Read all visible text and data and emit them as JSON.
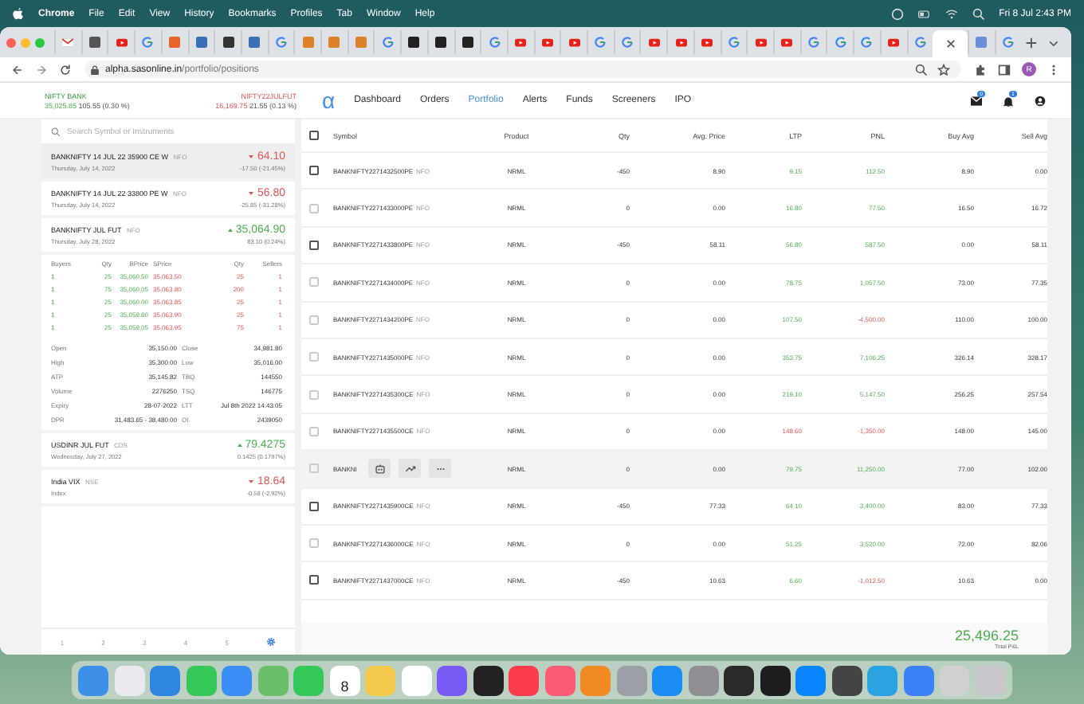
{
  "menu_bar": {
    "app": "Chrome",
    "items": [
      "File",
      "Edit",
      "View",
      "History",
      "Bookmarks",
      "Profiles",
      "Tab",
      "Window",
      "Help"
    ],
    "clock": "Fri 8 Jul  2:43 PM"
  },
  "browser_tabs": [
    {
      "kind": "mail",
      "selected": false
    },
    {
      "kind": "app",
      "color": "#555555",
      "selected": false
    },
    {
      "kind": "youtube",
      "selected": false
    },
    {
      "kind": "google",
      "selected": false
    },
    {
      "kind": "app",
      "color": "#e8632b",
      "selected": false
    },
    {
      "kind": "app",
      "color": "#3b6fb6",
      "selected": false
    },
    {
      "kind": "app",
      "color": "#333333",
      "selected": false
    },
    {
      "kind": "app",
      "color": "#3b6fb6",
      "selected": false
    },
    {
      "kind": "google",
      "selected": false
    },
    {
      "kind": "app",
      "color": "#d9822b",
      "selected": false
    },
    {
      "kind": "app",
      "color": "#d9822b",
      "selected": false
    },
    {
      "kind": "app",
      "color": "#d9822b",
      "selected": false
    },
    {
      "kind": "google",
      "selected": false
    },
    {
      "kind": "app",
      "color": "#222222",
      "selected": false
    },
    {
      "kind": "app",
      "color": "#222222",
      "selected": false
    },
    {
      "kind": "app",
      "color": "#222222",
      "selected": false
    },
    {
      "kind": "google",
      "selected": false
    },
    {
      "kind": "youtube",
      "selected": false
    },
    {
      "kind": "youtube",
      "selected": false
    },
    {
      "kind": "youtube",
      "selected": false
    },
    {
      "kind": "google",
      "selected": false
    },
    {
      "kind": "google",
      "selected": false
    },
    {
      "kind": "youtube",
      "selected": false
    },
    {
      "kind": "youtube",
      "selected": false
    },
    {
      "kind": "youtube",
      "selected": false
    },
    {
      "kind": "google",
      "selected": false
    },
    {
      "kind": "youtube",
      "selected": false
    },
    {
      "kind": "youtube",
      "selected": false
    },
    {
      "kind": "google",
      "selected": false
    },
    {
      "kind": "google",
      "selected": false
    },
    {
      "kind": "google",
      "selected": false
    },
    {
      "kind": "youtube",
      "selected": false
    },
    {
      "kind": "google",
      "selected": false
    },
    {
      "kind": "blank",
      "selected": true
    },
    {
      "kind": "app",
      "color": "#6a8fd8",
      "selected": false
    },
    {
      "kind": "google",
      "selected": false
    }
  ],
  "address_bar": {
    "host": "alpha.sasonline.in",
    "path": "/portfolio/positions"
  },
  "profile_initial": "R",
  "indices": [
    {
      "name": "NIFTY BANK",
      "value": "35,025.85",
      "change": "105.55 (0.30 %)",
      "up": true
    },
    {
      "name": "NIFTY22JULFUT",
      "value": "16,169.75",
      "change": "21.55 (0.13 %)",
      "up": false
    }
  ],
  "logo": "α",
  "nav": [
    {
      "label": "Dashboard",
      "selected": false
    },
    {
      "label": "Orders",
      "selected": false
    },
    {
      "label": "Portfolio",
      "selected": true
    },
    {
      "label": "Alerts",
      "selected": false
    },
    {
      "label": "Funds",
      "selected": false
    },
    {
      "label": "Screeners",
      "selected": false
    },
    {
      "label": "IPO",
      "selected": false
    }
  ],
  "header_badges": {
    "messages": "0",
    "notifications": "1"
  },
  "search": {
    "placeholder": "Search Symbol or Instruments"
  },
  "watchlist": [
    {
      "name": "BANKNIFTY 14 JUL 22 35900 CE W",
      "exchange": "NFO",
      "date": "Thursday, July 14, 2022",
      "price": "64.10",
      "change": "-17.50 (-21.45%)",
      "up": false,
      "selected": true
    },
    {
      "name": "BANKNIFTY 14 JUL 22 33800 PE W",
      "exchange": "NFO",
      "date": "Thursday, July 14, 2022",
      "price": "56.80",
      "change": "-25.85 (-31.28%)",
      "up": false,
      "selected": false
    },
    {
      "name": "BANKNIFTY JUL FUT",
      "exchange": "NFO",
      "date": "Thursday, July 28, 2022",
      "price": "35,064.90",
      "change": "83.10 (0.24%)",
      "up": true,
      "selected": false,
      "depth": {
        "columns": [
          "Buyers",
          "Qty",
          "BPrice",
          "SPrice",
          "Qty",
          "Sellers"
        ],
        "rows": [
          [
            "1",
            "25",
            "35,060.50",
            "35,063.50",
            "25",
            "1"
          ],
          [
            "1",
            "75",
            "35,060.05",
            "35,063.80",
            "200",
            "1"
          ],
          [
            "1",
            "25",
            "35,060.00",
            "35,063.85",
            "25",
            "1"
          ],
          [
            "1",
            "25",
            "35,059.60",
            "35,063.90",
            "25",
            "1"
          ],
          [
            "1",
            "25",
            "35,059.05",
            "35,063.95",
            "75",
            "1"
          ]
        ]
      },
      "stats": [
        [
          "Open",
          "35,150.00",
          "Close",
          "34,981.80"
        ],
        [
          "High",
          "35,300.00",
          "Low",
          "35,016.00"
        ],
        [
          "ATP",
          "35,145.82",
          "TBQ",
          "144550"
        ],
        [
          "Volume",
          "2276250",
          "TSQ",
          "146775"
        ],
        [
          "Expiry",
          "28-07-2022",
          "LTT",
          "Jul 8th 2022 14:43:05"
        ],
        [
          "DPR",
          "31,483.65 - 38,480.00",
          "OI",
          "2439050"
        ]
      ]
    },
    {
      "name": "USDINR JUL FUT",
      "exchange": "CDS",
      "date": "Wednesday, July 27, 2022",
      "price": "79.4275",
      "change": "0.1425 (0.1797%)",
      "up": true,
      "selected": false
    },
    {
      "name": "India VIX",
      "exchange": "NSE",
      "date": "Index",
      "price": "18.64",
      "change": "-0.58 (-2.92%)",
      "up": false,
      "selected": false
    }
  ],
  "watchlist_pages": [
    {
      "label": "1",
      "selected": false
    },
    {
      "label": "2",
      "selected": false
    },
    {
      "label": "3",
      "selected": false
    },
    {
      "label": "4",
      "selected": false
    },
    {
      "label": "5",
      "selected": false
    }
  ],
  "positions": {
    "select_all_checked": false,
    "columns": [
      "Symbol",
      "Product",
      "Qty",
      "Avg. Price",
      "LTP",
      "PNL",
      "Buy Avg",
      "Sell Avg"
    ],
    "rows": [
      {
        "symbol": "BANKNIFTY2271432500PE",
        "exchange": "NFO",
        "product": "NRML",
        "qty": "-450",
        "avg": "8.90",
        "ltp": "9.15",
        "pnl": "112.50",
        "buy_avg": "8.90",
        "sell_avg": "0.00",
        "ltp_up": true,
        "pnl_up": true,
        "open": true,
        "hovered": false
      },
      {
        "symbol": "BANKNIFTY2271433000PE",
        "exchange": "NFO",
        "product": "NRML",
        "qty": "0",
        "avg": "0.00",
        "ltp": "16.80",
        "pnl": "77.50",
        "buy_avg": "16.50",
        "sell_avg": "16.72",
        "ltp_up": true,
        "pnl_up": true,
        "open": false,
        "hovered": false
      },
      {
        "symbol": "BANKNIFTY2271433800PE",
        "exchange": "NFO",
        "product": "NRML",
        "qty": "-450",
        "avg": "58.11",
        "ltp": "56.80",
        "pnl": "587.50",
        "buy_avg": "0.00",
        "sell_avg": "58.11",
        "ltp_up": true,
        "pnl_up": true,
        "open": true,
        "hovered": false
      },
      {
        "symbol": "BANKNIFTY2271434000PE",
        "exchange": "NFO",
        "product": "NRML",
        "qty": "0",
        "avg": "0.00",
        "ltp": "78.75",
        "pnl": "1,057.50",
        "buy_avg": "73.00",
        "sell_avg": "77.35",
        "ltp_up": true,
        "pnl_up": true,
        "open": false,
        "hovered": false
      },
      {
        "symbol": "BANKNIFTY2271434200PE",
        "exchange": "NFO",
        "product": "NRML",
        "qty": "0",
        "avg": "0.00",
        "ltp": "107.50",
        "pnl": "-4,500.00",
        "buy_avg": "110.00",
        "sell_avg": "100.00",
        "ltp_up": true,
        "pnl_up": false,
        "open": false,
        "hovered": false
      },
      {
        "symbol": "BANKNIFTY2271435000PE",
        "exchange": "NFO",
        "product": "NRML",
        "qty": "0",
        "avg": "0.00",
        "ltp": "353.75",
        "pnl": "7,106.25",
        "buy_avg": "326.14",
        "sell_avg": "328.17",
        "ltp_up": true,
        "pnl_up": true,
        "open": false,
        "hovered": false
      },
      {
        "symbol": "BANKNIFTY2271435300CE",
        "exchange": "NFO",
        "product": "NRML",
        "qty": "0",
        "avg": "0.00",
        "ltp": "219.10",
        "pnl": "5,147.50",
        "buy_avg": "256.25",
        "sell_avg": "257.54",
        "ltp_up": true,
        "pnl_up": true,
        "open": false,
        "hovered": false
      },
      {
        "symbol": "BANKNIFTY2271435500CE",
        "exchange": "NFO",
        "product": "NRML",
        "qty": "0",
        "avg": "0.00",
        "ltp": "148.60",
        "pnl": "-1,350.00",
        "buy_avg": "148.00",
        "sell_avg": "145.00",
        "ltp_up": false,
        "pnl_up": false,
        "open": false,
        "hovered": false
      },
      {
        "symbol": "BANKNI",
        "product": "NRML",
        "qty": "0",
        "avg": "0.00",
        "ltp": "79.75",
        "pnl": "11,250.00",
        "buy_avg": "77.00",
        "sell_avg": "102.00",
        "ltp_up": true,
        "pnl_up": true,
        "open": false,
        "hovered": true
      },
      {
        "symbol": "BANKNIFTY2271435900CE",
        "exchange": "NFO",
        "product": "NRML",
        "qty": "-450",
        "avg": "77.33",
        "ltp": "64.10",
        "pnl": "3,400.00",
        "buy_avg": "83.00",
        "sell_avg": "77.33",
        "ltp_up": true,
        "pnl_up": true,
        "open": true,
        "hovered": false
      },
      {
        "symbol": "BANKNIFTY2271436000CE",
        "exchange": "NFO",
        "product": "NRML",
        "qty": "0",
        "avg": "0.00",
        "ltp": "51.25",
        "pnl": "3,520.00",
        "buy_avg": "72.00",
        "sell_avg": "82.06",
        "ltp_up": true,
        "pnl_up": true,
        "open": false,
        "hovered": false
      },
      {
        "symbol": "BANKNIFTY2271437000CE",
        "exchange": "NFO",
        "product": "NRML",
        "qty": "-450",
        "avg": "10.63",
        "ltp": "6.60",
        "pnl": "-1,012.50",
        "buy_avg": "10.63",
        "sell_avg": "0.00",
        "ltp_up": true,
        "pnl_up": false,
        "open": true,
        "hovered": false
      }
    ],
    "total": {
      "value": "25,496.25",
      "label": "Total P&L",
      "up": true
    }
  },
  "dock": [
    {
      "color": "#3d8fe8"
    },
    {
      "color": "#e9e9ef"
    },
    {
      "color": "#2f86e0"
    },
    {
      "color": "#35c759"
    },
    {
      "color": "#3a8ef5"
    },
    {
      "color": "#6cbf6a"
    },
    {
      "color": "#34c759"
    },
    {
      "kind": "calendar",
      "text": "8",
      "color": "#ffffff"
    },
    {
      "color": "#f2c94c"
    },
    {
      "color": "#ffffff"
    },
    {
      "color": "#7a5af5"
    },
    {
      "color": "#222222"
    },
    {
      "color": "#fa3c4c"
    },
    {
      "color": "#fb5c74"
    },
    {
      "color": "#f08a24"
    },
    {
      "color": "#9aa0a6"
    },
    {
      "color": "#1b8cf5"
    },
    {
      "color": "#8e8e93"
    },
    {
      "color": "#2a2a2a"
    },
    {
      "color": "#1e1e1e"
    },
    {
      "color": "#0a84ff"
    },
    {
      "color": "#444444"
    },
    {
      "color": "#2aa3e0"
    },
    {
      "color": "#3b82f6"
    },
    {
      "color": "#d0d0d0"
    },
    {
      "color": "#c7c7cc"
    }
  ]
}
